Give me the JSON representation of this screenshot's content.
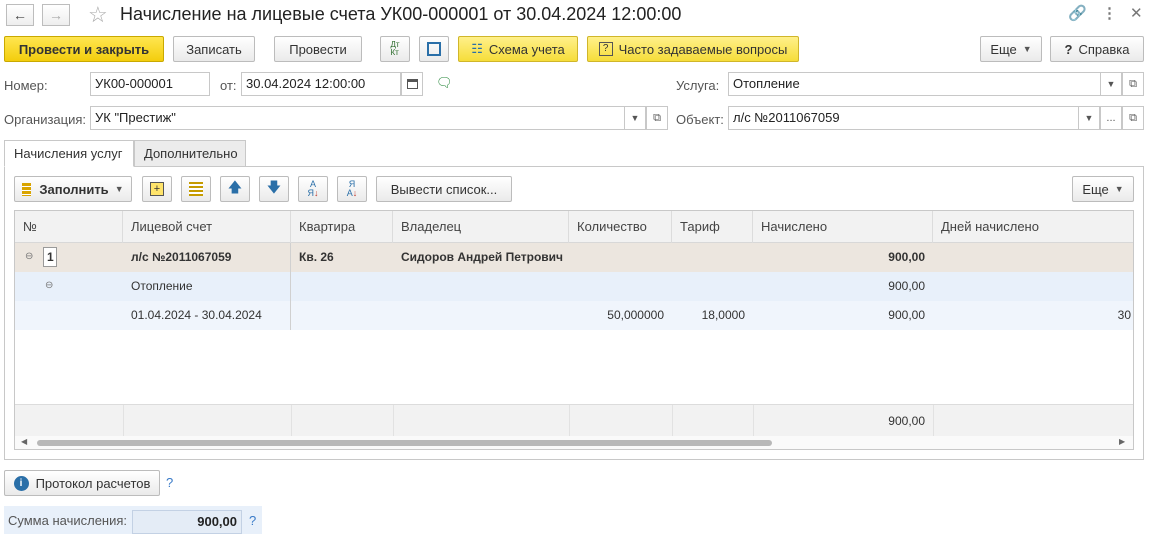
{
  "window": {
    "title": "Начисление на лицевые счета УК00-000001 от 30.04.2024 12:00:00"
  },
  "toolbar": {
    "post_close": "Провести и закрыть",
    "save": "Записать",
    "post": "Провести",
    "scheme": "Схема учета",
    "faq": "Часто задаваемые вопросы",
    "more": "Еще",
    "help": "Справка"
  },
  "form": {
    "number_label": "Номер:",
    "number_value": "УК00-000001",
    "date_label": "от:",
    "date_value": "30.04.2024 12:00:00",
    "org_label": "Организация:",
    "org_value": "УК \"Престиж\"",
    "service_label": "Услуга:",
    "service_value": "Отопление",
    "object_label": "Объект:",
    "object_value": "л/с №2011067059"
  },
  "tabs": [
    "Начисления услуг",
    "Дополнительно"
  ],
  "table_toolbar": {
    "fill": "Заполнить",
    "output_list": "Вывести список...",
    "more": "Еще"
  },
  "table": {
    "headers": [
      "№",
      "Лицевой счет",
      "Квартира",
      "Владелец",
      "Количество",
      "Тариф",
      "Начислено",
      "Дней начислено"
    ],
    "rows": [
      {
        "num": "1",
        "account": "л/с №2011067059",
        "flat": "Кв. 26",
        "owner": "Сидоров Андрей Петрович",
        "amount": "900,00"
      },
      {
        "account": "Отопление",
        "amount": "900,00"
      },
      {
        "account": "01.04.2024 - 30.04.2024",
        "qty": "50,000000",
        "tariff": "18,0000",
        "amount": "900,00",
        "days": "30"
      }
    ],
    "footer_total": "900,00"
  },
  "bottom": {
    "protocol": "Протокол расчетов",
    "sum_label": "Сумма начисления:",
    "sum_value": "900,00",
    "help_mark": "?"
  }
}
